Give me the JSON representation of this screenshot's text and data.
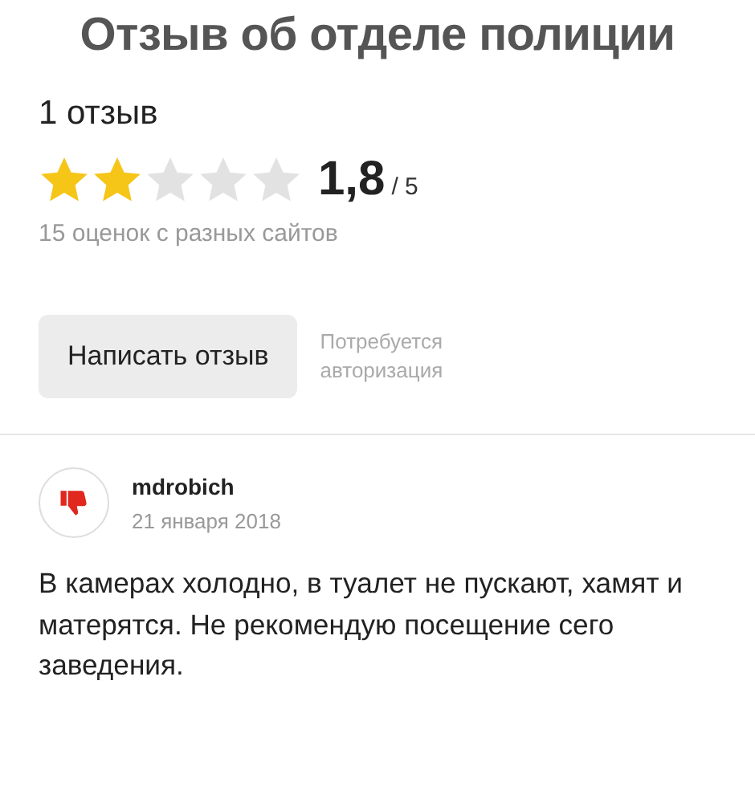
{
  "title": "Отзыв об отделе полиции",
  "review_count": "1 отзыв",
  "rating": {
    "stars": 2,
    "score": "1,8",
    "scale": "/ 5",
    "ratings_note": "15 оценок с разных сайтов"
  },
  "write_button": "Написать отзыв",
  "auth_note": "Потребуется авторизация",
  "reviews": [
    {
      "author": "mdrobich",
      "date": "21 января 2018",
      "text": "В камерах холодно, в туалет не пускают, хамят и матерятся. Не рекомендую посещение сего заведения."
    }
  ]
}
